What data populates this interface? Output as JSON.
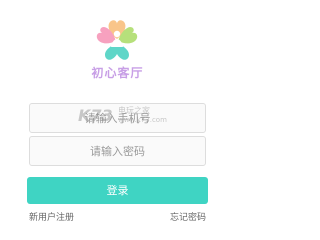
{
  "app": {
    "name": "初心客厅"
  },
  "login": {
    "phone_placeholder": "请输入手机号",
    "password_placeholder": "请输入密码",
    "submit_label": "登录"
  },
  "links": {
    "register": "新用户注册",
    "forgot_password": "忘记密码"
  },
  "watermark": {
    "mark": "K73",
    "name": "电玩之家",
    "url": "www.k73.com"
  },
  "icons": {
    "logo": "clover-heart-logo-icon"
  },
  "colors": {
    "accent": "#3fd4c3",
    "brand_text": "#c89fe6",
    "logo_pink": "#f7a1bf",
    "logo_orange": "#f9c58a",
    "logo_teal": "#5fd6c8",
    "logo_lime": "#b6e07b"
  }
}
